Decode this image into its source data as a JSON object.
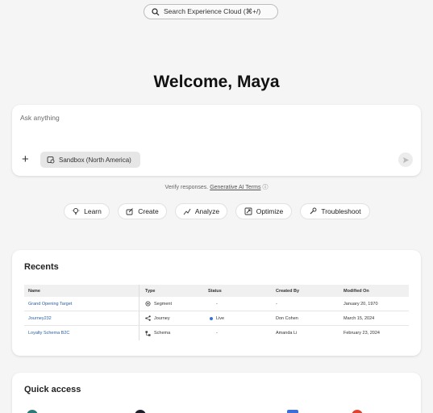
{
  "search": {
    "placeholder": "Search Experience Cloud (⌘+/)"
  },
  "welcome": "Welcome, Maya",
  "prompt": {
    "placeholder": "Ask anything",
    "sandbox_label": "Sandbox (North America)"
  },
  "disclaimer": {
    "text": "Verify responses.",
    "link": "Generative AI Terms",
    "info_icon": "ⓘ"
  },
  "chips": [
    {
      "label": "Learn",
      "icon": "lightbulb-icon"
    },
    {
      "label": "Create",
      "icon": "create-icon"
    },
    {
      "label": "Analyze",
      "icon": "chart-icon"
    },
    {
      "label": "Optimize",
      "icon": "optimize-icon"
    },
    {
      "label": "Troubleshoot",
      "icon": "wrench-icon"
    }
  ],
  "recents": {
    "title": "Recents",
    "columns": [
      "Name",
      "Type",
      "Status",
      "Created By",
      "Modified On"
    ],
    "rows": [
      {
        "name": "Grand Opening Target",
        "type": "Segment",
        "type_icon": "segment-icon",
        "status": "-",
        "created_by": "-",
        "modified_on": "January 20, 1970"
      },
      {
        "name": "Journey232",
        "type": "Journey",
        "type_icon": "journey-icon",
        "status": "Live",
        "created_by": "Don Cohen",
        "modified_on": "March 15, 2024"
      },
      {
        "name": "Loyalty Schema B2C",
        "type": "Schema",
        "type_icon": "schema-icon",
        "status": "-",
        "created_by": "Amanda Li",
        "modified_on": "February 23, 2024"
      }
    ]
  },
  "quick_access": {
    "title": "Quick access"
  },
  "colors": {
    "link": "#2c5ea3",
    "live_dot": "#3b72d9",
    "qa_teal": "#2b7a78",
    "qa_dark": "#1d1d2b",
    "qa_blue": "#3b6fd6",
    "qa_red": "#e0412f"
  }
}
